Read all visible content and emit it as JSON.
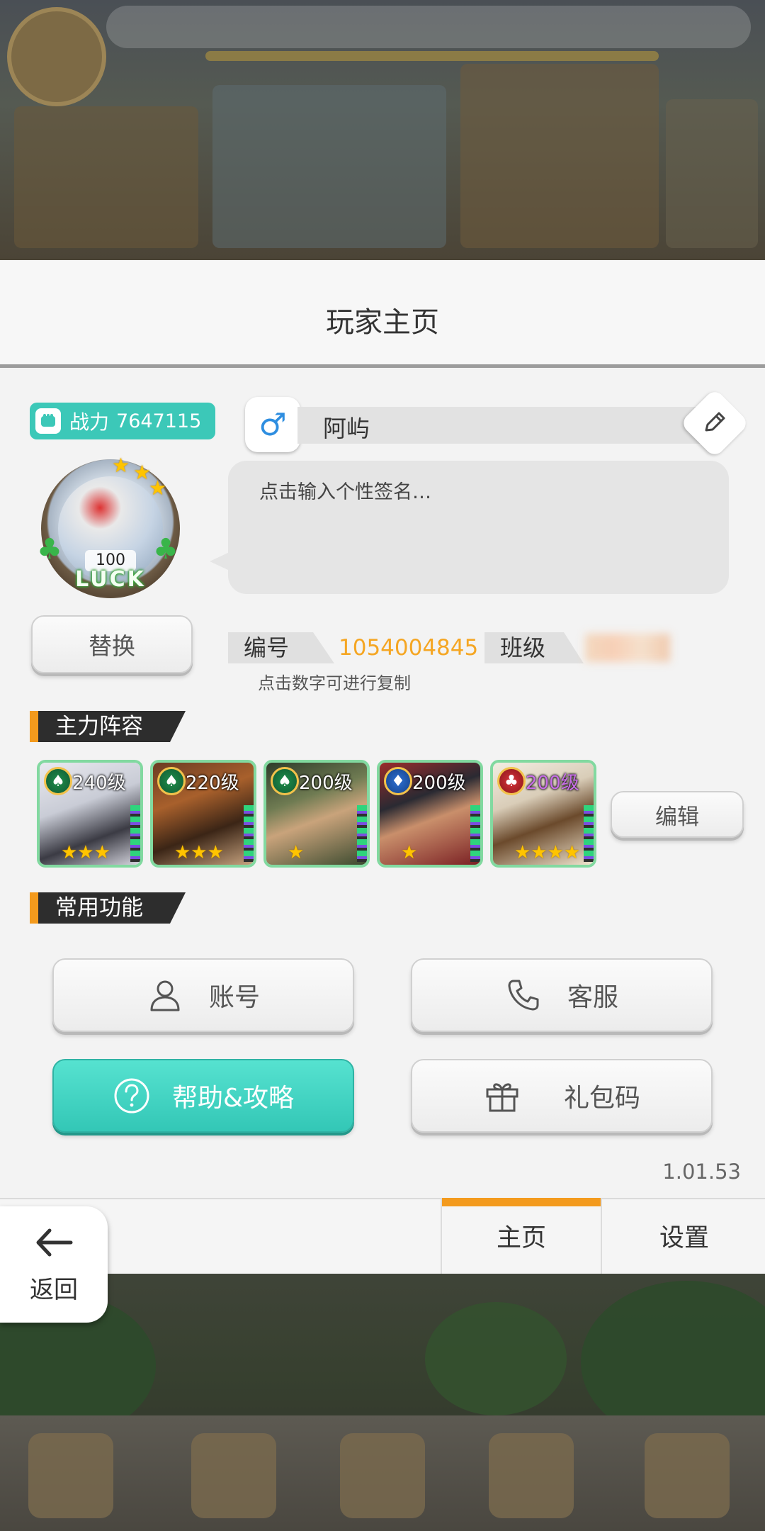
{
  "panel": {
    "title": "玩家主页"
  },
  "profile": {
    "power_label": "战力",
    "power_value": "7647115",
    "gender_symbol": "♂",
    "name": "阿屿",
    "level": "100",
    "frame_text": "LUCK",
    "signature_placeholder": "点击输入个性签名…",
    "replace_button": "替换",
    "id_label": "编号",
    "id_value": "1054004845",
    "class_label": "班级",
    "copy_hint": "点击数字可进行复制"
  },
  "lineup": {
    "title": "主力阵容",
    "edit_button": "编辑",
    "heroes": [
      {
        "level": "240级",
        "suit": "♠",
        "suit_color": "#1e8e4b",
        "stars": "★★★"
      },
      {
        "level": "220级",
        "suit": "♠",
        "suit_color": "#1e8e4b",
        "stars": "★★★"
      },
      {
        "level": "200级",
        "suit": "♠",
        "suit_color": "#1e8e4b",
        "stars": "★"
      },
      {
        "level": "200级",
        "suit": "♦",
        "suit_color": "#2d6fd3",
        "stars": "★"
      },
      {
        "level": "200级",
        "suit": "♣",
        "suit_color": "#d8343a",
        "stars": "★★★★"
      }
    ]
  },
  "functions": {
    "title": "常用功能",
    "account": "账号",
    "service": "客服",
    "help": "帮助&攻略",
    "gift_code": "礼包码"
  },
  "version": "1.01.53",
  "tabs": {
    "home": "主页",
    "settings": "设置"
  },
  "back": {
    "label": "返回"
  },
  "colors": {
    "accent_orange": "#f39a1d",
    "teal": "#3cc8b8",
    "id_orange": "#f5a623"
  }
}
